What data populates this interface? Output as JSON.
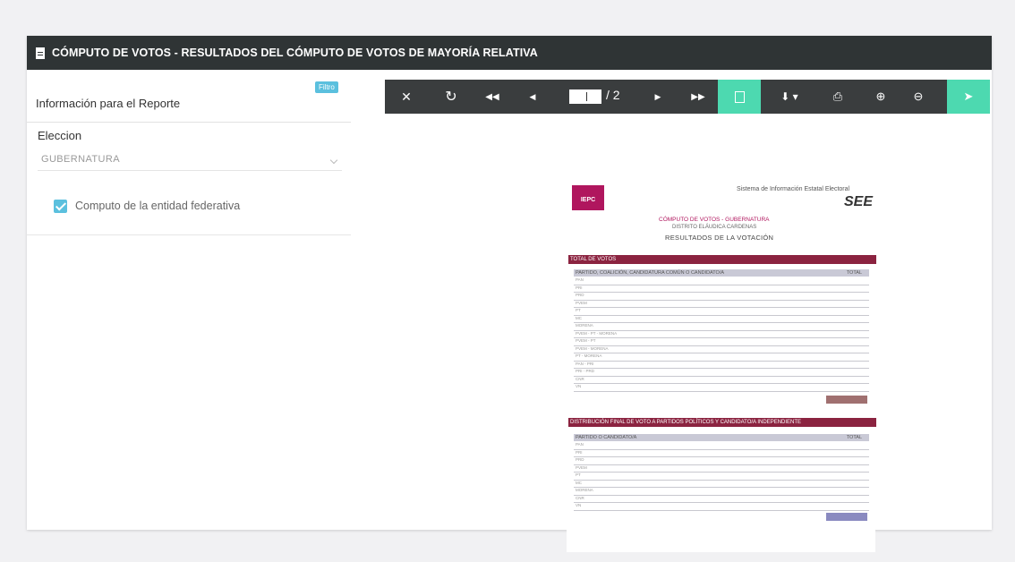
{
  "window": {
    "title": "CÓMPUTO DE VOTOS - RESULTADOS DEL CÓMPUTO DE VOTOS DE MAYORÍA RELATIVA"
  },
  "left_panel": {
    "info_label": "Información para el Reporte",
    "badge": "Filtro",
    "election_label": "Eleccion",
    "election_value": "GUBERNATURA",
    "checkbox_label": "Computo de la entidad federativa",
    "checkbox_checked": true
  },
  "viewer": {
    "toolbar_icons": [
      "close-icon",
      "refresh-icon",
      "first-page-icon",
      "previous-page-icon",
      "next-page-icon",
      "last-page-icon",
      "document-icon",
      "download-icon",
      "print-icon",
      "zoom-in-icon",
      "zoom-out-icon",
      "send-icon"
    ],
    "page_current": "1",
    "page_total": "/ 2",
    "accent": "#4dd9b0"
  },
  "report": {
    "logo": "IEPC",
    "system_name": "Sistema de Información Estatal Electoral",
    "system_short": "SEE",
    "sub1": "CÓMPUTO DE VOTOS - GUBERNATURA",
    "sub2": "DISTRITO ELÁUDICA CARDENAS",
    "sub3": "RESULTADOS DE LA VOTACIÓN",
    "section1_title": "TOTAL DE VOTOS",
    "table1_col1": "PARTIDO, COALICIÓN, CANDIDATURA COMÚN O CANDIDATO/A",
    "table1_col2": "TOTAL",
    "table1_rows": [
      "PAN",
      "PRI",
      "PRD",
      "PVEM",
      "PT",
      "MC",
      "MORENA",
      "PVEM - PT - MORENA",
      "PVEM - PT",
      "PVEM - MORENA",
      "PT - MORENA",
      "PAN - PRI",
      "PRI - PRD",
      "CNR",
      "VN"
    ],
    "section2_title": "DISTRIBUCIÓN FINAL DE VOTO A PARTIDOS POLÍTICOS Y CANDIDATO/A INDEPENDIENTE",
    "table2_col1": "PARTIDO O CANDIDATO/A",
    "table2_col2": "TOTAL",
    "table2_rows": [
      "PAN",
      "PRI",
      "PRD",
      "PVEM",
      "PT",
      "MC",
      "MORENA",
      "CNR",
      "VN"
    ]
  },
  "colors": {
    "brand": "#b0165e",
    "section_bar": "#8b2340",
    "titlebar": "#2f3435",
    "badge": "#5bc0de"
  }
}
